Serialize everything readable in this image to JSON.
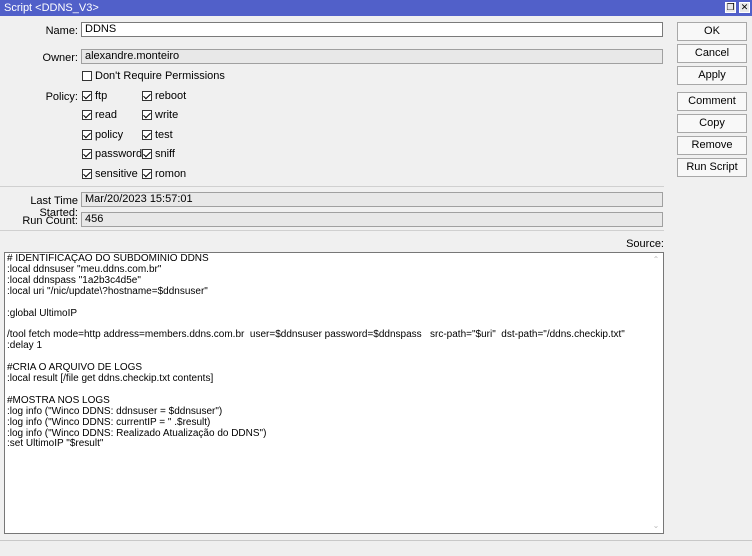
{
  "window": {
    "title": "Script <DDNS_V3>",
    "restore_glyph": "❐",
    "close_glyph": "✕"
  },
  "form": {
    "name_label": "Name:",
    "name_value": "DDNS",
    "owner_label": "Owner:",
    "owner_value": "alexandre.monteiro",
    "dont_require_permissions": {
      "label": "Don't Require Permissions",
      "checked": false
    },
    "policy_label": "Policy:",
    "policies": [
      {
        "label": "ftp",
        "checked": true
      },
      {
        "label": "reboot",
        "checked": true
      },
      {
        "label": "read",
        "checked": true
      },
      {
        "label": "write",
        "checked": true
      },
      {
        "label": "policy",
        "checked": true
      },
      {
        "label": "test",
        "checked": true
      },
      {
        "label": "password",
        "checked": true
      },
      {
        "label": "sniff",
        "checked": true
      },
      {
        "label": "sensitive",
        "checked": true
      },
      {
        "label": "romon",
        "checked": true
      }
    ],
    "last_time_started_label": "Last Time Started:",
    "last_time_started_value": "Mar/20/2023 15:57:01",
    "run_count_label": "Run Count:",
    "run_count_value": "456",
    "source_label": "Source:",
    "source_text": "# IDENTIFICAÇÃO DO SUBDOMINIO DDNS\n:local ddnsuser \"meu.ddns.com.br\"\n:local ddnspass \"1a2b3c4d5e\"\n:local uri \"/nic/update\\?hostname=$ddnsuser\"\n\n:global UltimoIP\n\n/tool fetch mode=http address=members.ddns.com.br  user=$ddnsuser password=$ddnspass   src-path=\"$uri\"  dst-path=\"/ddns.checkip.txt\"\n:delay 1\n\n#CRIA O ARQUIVO DE LOGS\n:local result [/file get ddns.checkip.txt contents]\n\n#MOSTRA NOS LOGS\n:log info (\"Winco DDNS: ddnsuser = $ddnsuser\")\n:log info (\"Winco DDNS: currentIP = \" .$result)\n:log info (\"Winco DDNS: Realizado Atualização do DDNS\")\n:set UltimoIP \"$result\""
  },
  "buttons": {
    "ok": "OK",
    "cancel": "Cancel",
    "apply": "Apply",
    "comment": "Comment",
    "copy": "Copy",
    "remove": "Remove",
    "run_script": "Run Script"
  },
  "scroll": {
    "up_glyph": "⌃",
    "down_glyph": "⌄"
  }
}
